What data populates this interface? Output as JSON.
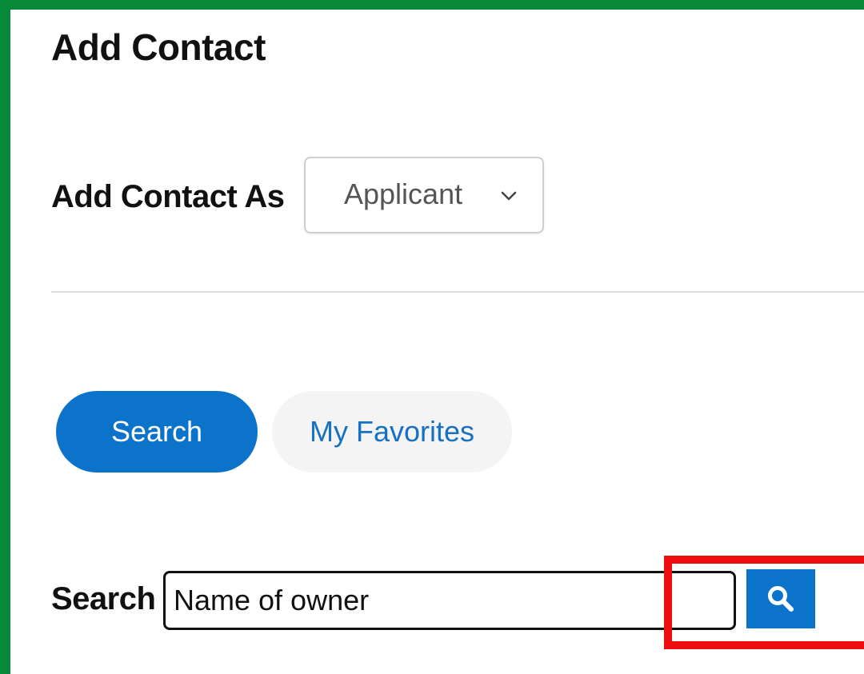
{
  "colors": {
    "frame": "#07893a",
    "primary": "#0b73c9",
    "highlight": "#ee0d0d"
  },
  "page_title": "Add Contact",
  "add_contact_as": {
    "label": "Add Contact As",
    "selected": "Applicant",
    "icon": "chevron-down-icon"
  },
  "tabs": [
    {
      "label": "Search",
      "active": true
    },
    {
      "label": "My Favorites",
      "active": false
    }
  ],
  "search": {
    "label": "Search",
    "placeholder": "Name of owner",
    "button_icon": "magnifier-icon"
  }
}
